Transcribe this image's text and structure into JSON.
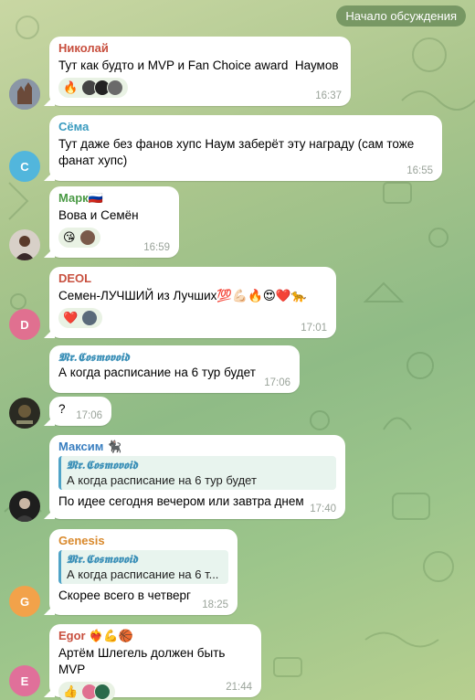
{
  "header": {
    "discussion_label": "Начало обсуждения"
  },
  "messages": [
    {
      "author": "Николай",
      "author_color": "#c8503f",
      "text": "Тут как будто и MVP и Fan Choice award  Наумов",
      "time": "16:37",
      "avatar_initial": "",
      "reaction_emoji": "🔥"
    },
    {
      "author": "Сёма",
      "author_color": "#3a9bbf",
      "text": "Тут даже без фанов хупс Наум заберёт эту награду (сам тоже фанат хупс)",
      "time": "16:55",
      "avatar_initial": "С",
      "avatar_color": "#52b6dc"
    },
    {
      "author": "Марк",
      "author_emoji": "🇷🇺",
      "author_color": "#4a9a45",
      "text": "Вова и Семён",
      "time": "16:59",
      "avatar_initial": "",
      "reaction_emoji": "😘"
    },
    {
      "author": "DEOL",
      "author_color": "#c8503f",
      "text": "Семен-ЛУЧШИЙ из Лучших💯💪🏻🔥😍❤️🐆",
      "time": "17:01",
      "avatar_initial": "D",
      "avatar_color": "#e07090",
      "reaction_emoji": "❤️"
    },
    {
      "quote_author": "𝕸𝖗.𝕮𝖔𝖘𝖒𝖔𝖛𝖔𝖎𝖉",
      "text": "А когда расписание на 6 тур будет",
      "time": "17:06"
    },
    {
      "text": "?",
      "time": "17:06",
      "avatar_initial": ""
    },
    {
      "author": "Максим",
      "author_emoji": "🐈‍⬛",
      "author_color": "#3a7fc0",
      "quote_author": "𝕸𝖗.𝕮𝖔𝖘𝖒𝖔𝖛𝖔𝖎𝖉",
      "quote_text": "А когда расписание на 6 тур будет",
      "text": "По идее сегодня вечером или завтра днем",
      "time": "17:40",
      "avatar_initial": ""
    },
    {
      "author": "Genesis",
      "author_color": "#d9892c",
      "quote_author": "𝕸𝖗.𝕮𝖔𝖘𝖒𝖔𝖛𝖔𝖎𝖉",
      "quote_text": "А когда расписание на 6 т...",
      "text": "Скорее всего в четверг",
      "time": "18:25",
      "avatar_initial": "G",
      "avatar_color": "#f2a24a"
    },
    {
      "author": "Egor",
      "author_emoji": "❤️‍🔥💪🏀",
      "author_color": "#c8503f",
      "text": "Артём Шлегель должен быть MVP",
      "time": "21:44",
      "avatar_initial": "E",
      "avatar_color": "#e0709a",
      "reaction_emoji": "👍"
    }
  ]
}
